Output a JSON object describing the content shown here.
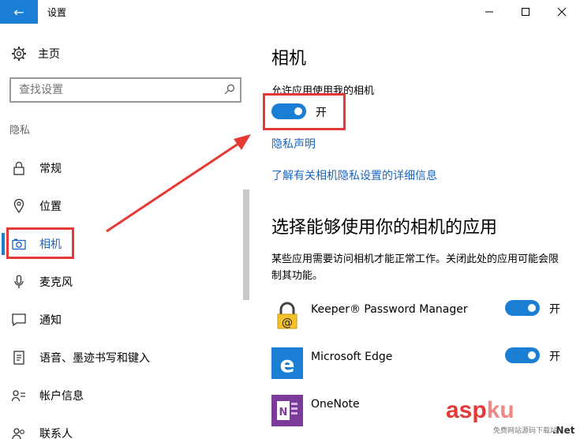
{
  "titlebar": {
    "back_label": "←",
    "title": "设置",
    "minimize": "—",
    "maximize": "☐",
    "close": "✕"
  },
  "nav": {
    "home_label": "主页",
    "search_placeholder": "查找设置",
    "section_label": "隐私",
    "items": [
      {
        "label": "常规",
        "icon": "lock-icon"
      },
      {
        "label": "位置",
        "icon": "location-icon"
      },
      {
        "label": "相机",
        "icon": "camera-icon"
      },
      {
        "label": "麦克风",
        "icon": "microphone-icon"
      },
      {
        "label": "通知",
        "icon": "notification-icon"
      },
      {
        "label": "语音、墨迹书写和键入",
        "icon": "speech-icon"
      },
      {
        "label": "帐户信息",
        "icon": "account-icon"
      },
      {
        "label": "联系人",
        "icon": "contacts-icon"
      }
    ]
  },
  "main": {
    "title": "相机",
    "allow_label": "允许应用使用我的相机",
    "toggle_state": "开",
    "privacy_link": "隐私声明",
    "more_link": "了解有关相机隐私设置的详细信息",
    "section_title": "选择能够使用你的相机的应用",
    "description": "某些应用需要访问相机才能正常工作。关闭此处的应用可能会限制其功能。",
    "apps": [
      {
        "name": "Keeper® Password Manager",
        "state": "开"
      },
      {
        "name": "Microsoft Edge",
        "state": "开"
      },
      {
        "name": "OneNote",
        "state": ""
      }
    ]
  },
  "watermark": {
    "main": "asp",
    "ku": "ku",
    "sub": "免费网站源码下载站",
    "net": ".Net"
  },
  "colors": {
    "accent": "#1a7ed4",
    "annotation": "#e53935"
  }
}
